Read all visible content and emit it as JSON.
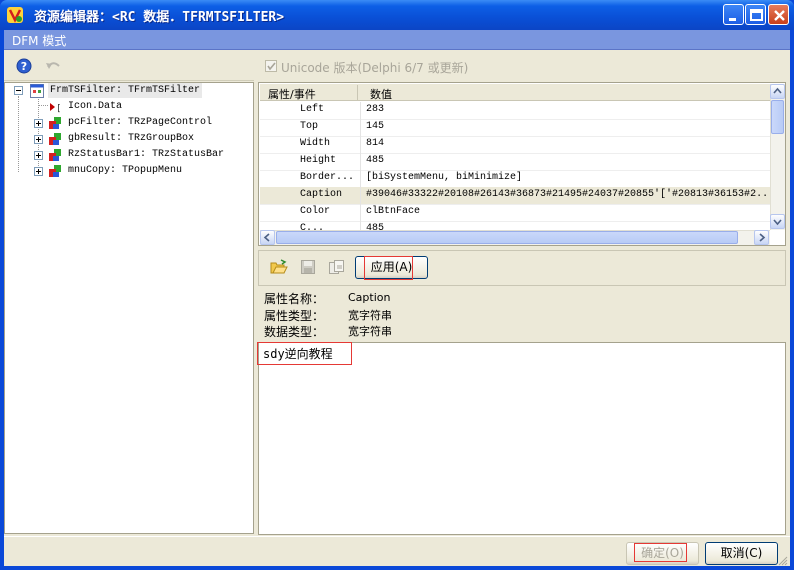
{
  "window": {
    "title": "资源编辑器：<RC 数据．TFRMTSFILTER>",
    "icon": "app-logo-icon",
    "controls": [
      "minimize-icon",
      "maximize-icon",
      "close-icon"
    ]
  },
  "header": {
    "mode_label": "DFM 模式"
  },
  "left_toolbar": {
    "icons": [
      "help-icon",
      "undo-icon"
    ]
  },
  "tree": {
    "root": "FrmTSFilter: TFrmTSFilter",
    "items": [
      {
        "label": "Icon.Data",
        "icon": "data-arrow-icon",
        "expandable": false
      },
      {
        "label": "pcFilter: TRzPageControl",
        "icon": "component-icon",
        "expandable": true
      },
      {
        "label": "gbResult: TRzGroupBox",
        "icon": "component-icon",
        "expandable": true
      },
      {
        "label": "RzStatusBar1: TRzStatusBar",
        "icon": "component-icon",
        "expandable": true
      },
      {
        "label": "mnuCopy: TPopupMenu",
        "icon": "component-icon",
        "expandable": true
      }
    ]
  },
  "unicode_option": {
    "label": "Unicode 版本(Delphi 6/7 或更新)",
    "checked": true,
    "enabled": false
  },
  "grid": {
    "headers": [
      "属性/事件",
      "数值"
    ],
    "rows": [
      {
        "name": "Left",
        "value": "283"
      },
      {
        "name": "Top",
        "value": "145"
      },
      {
        "name": "Width",
        "value": "814"
      },
      {
        "name": "Height",
        "value": "485"
      },
      {
        "name": "Border...",
        "value": "[biSystemMenu, biMinimize]"
      },
      {
        "name": "Caption",
        "value": "#39046#33322#20108#26143#36873#21495#24037#20855'['#20813#36153#2...",
        "selected": true
      },
      {
        "name": "Color",
        "value": "clBtnFace"
      },
      {
        "name": "C...",
        "value": "485"
      }
    ]
  },
  "editor_toolbar": {
    "icons": [
      "open-folder-icon",
      "save-disk-icon",
      "copy-icon"
    ],
    "apply_label": "应用(A)"
  },
  "info": {
    "prop_name_label": "属性名称：",
    "prop_name_value": "Caption",
    "prop_type_label": "属性类型：",
    "prop_type_value": "宽字符串",
    "data_type_label": "数据类型：",
    "data_type_value": "宽字符串"
  },
  "editor": {
    "text": "sdy逆向教程"
  },
  "buttons": {
    "ok_label": "确定(O)",
    "cancel_label": "取消(C)"
  },
  "colors": {
    "titlebar": "#0a4fd6",
    "strip": "#7a96df",
    "highlight": "#e53935"
  }
}
